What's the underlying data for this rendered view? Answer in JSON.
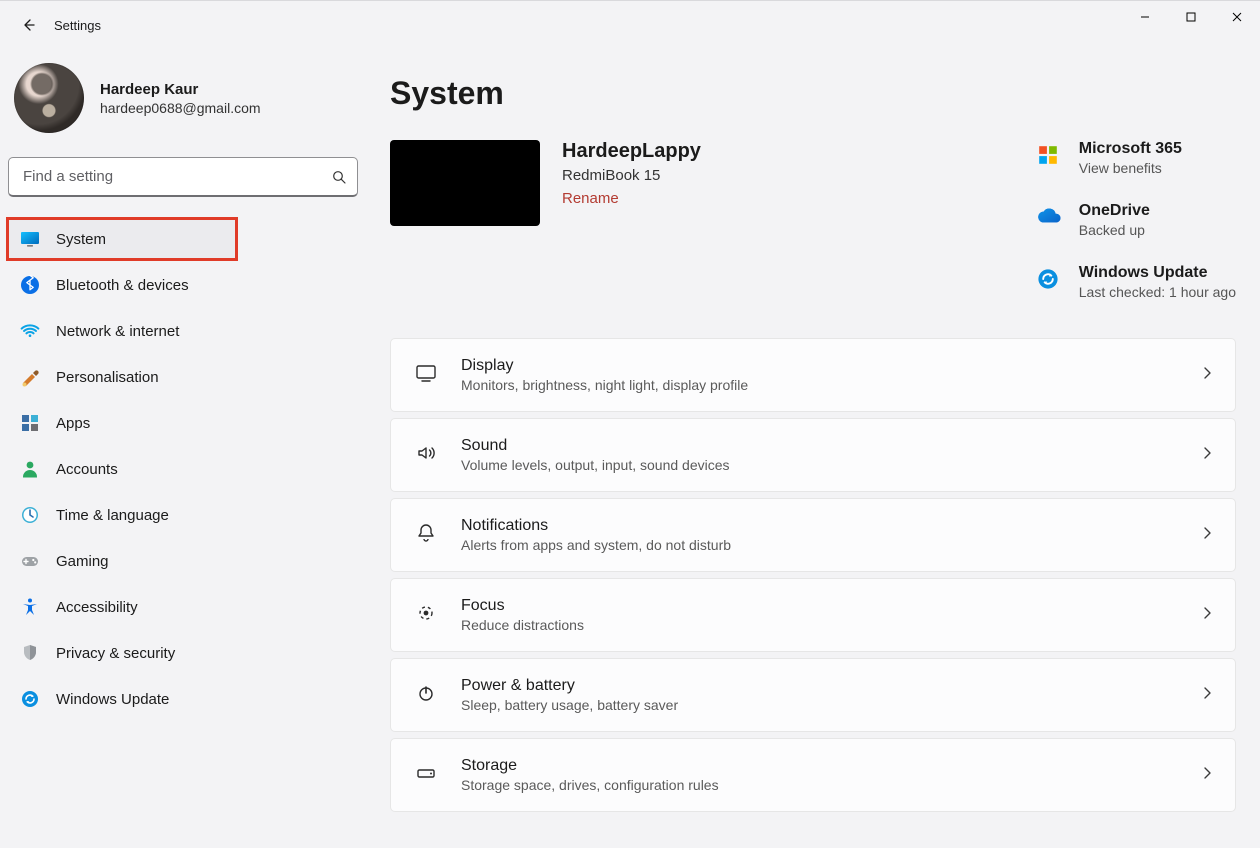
{
  "window": {
    "title": "Settings",
    "minimize": "Minimize",
    "maximize": "Maximize",
    "close": "Close"
  },
  "profile": {
    "name": "Hardeep Kaur",
    "email": "hardeep0688@gmail.com"
  },
  "search": {
    "placeholder": "Find a setting"
  },
  "nav": {
    "items": [
      {
        "id": "system",
        "label": "System",
        "selected": true,
        "highlighted": true
      },
      {
        "id": "bluetooth",
        "label": "Bluetooth & devices",
        "selected": false,
        "highlighted": false
      },
      {
        "id": "network",
        "label": "Network & internet",
        "selected": false,
        "highlighted": false
      },
      {
        "id": "personalisation",
        "label": "Personalisation",
        "selected": false,
        "highlighted": false
      },
      {
        "id": "apps",
        "label": "Apps",
        "selected": false,
        "highlighted": false
      },
      {
        "id": "accounts",
        "label": "Accounts",
        "selected": false,
        "highlighted": false
      },
      {
        "id": "time",
        "label": "Time & language",
        "selected": false,
        "highlighted": false
      },
      {
        "id": "gaming",
        "label": "Gaming",
        "selected": false,
        "highlighted": false
      },
      {
        "id": "accessibility",
        "label": "Accessibility",
        "selected": false,
        "highlighted": false
      },
      {
        "id": "privacy",
        "label": "Privacy & security",
        "selected": false,
        "highlighted": false
      },
      {
        "id": "update",
        "label": "Windows Update",
        "selected": false,
        "highlighted": false
      }
    ]
  },
  "page": {
    "heading": "System",
    "device": {
      "pc_name": "HardeepLappy",
      "model": "RedmiBook 15",
      "rename": "Rename"
    },
    "tiles": {
      "m365": {
        "title": "Microsoft 365",
        "sub": "View benefits"
      },
      "onedrive": {
        "title": "OneDrive",
        "sub": "Backed up"
      },
      "update": {
        "title": "Windows Update",
        "sub": "Last checked: 1 hour ago"
      }
    },
    "items": [
      {
        "id": "display",
        "title": "Display",
        "sub": "Monitors, brightness, night light, display profile"
      },
      {
        "id": "sound",
        "title": "Sound",
        "sub": "Volume levels, output, input, sound devices"
      },
      {
        "id": "notifications",
        "title": "Notifications",
        "sub": "Alerts from apps and system, do not disturb"
      },
      {
        "id": "focus",
        "title": "Focus",
        "sub": "Reduce distractions"
      },
      {
        "id": "power",
        "title": "Power & battery",
        "sub": "Sleep, battery usage, battery saver"
      },
      {
        "id": "storage",
        "title": "Storage",
        "sub": "Storage space, drives, configuration rules"
      }
    ]
  }
}
